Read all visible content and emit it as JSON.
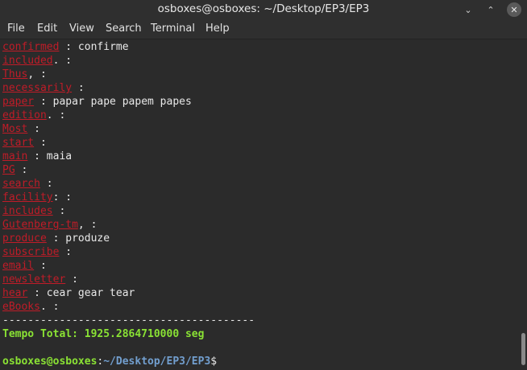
{
  "window": {
    "title": "osboxes@osboxes: ~/Desktop/EP3/EP3",
    "minimize": "⌄",
    "maximize": "⌃",
    "close": "✕"
  },
  "menu": [
    "File",
    "Edit",
    "View",
    "Search",
    "Terminal",
    "Help"
  ],
  "output": [
    {
      "word": "confirmed",
      "tail": " : confirme"
    },
    {
      "word": "included",
      "tail": ". :"
    },
    {
      "word": "Thus",
      "tail": ", :"
    },
    {
      "word": "necessarily",
      "tail": " :"
    },
    {
      "word": "paper",
      "tail": " : papar pape papem papes"
    },
    {
      "word": "edition",
      "tail": ". :"
    },
    {
      "word": "Most",
      "tail": " :"
    },
    {
      "word": "start",
      "tail": " :"
    },
    {
      "word": "main",
      "tail": " : maia"
    },
    {
      "word": "PG",
      "tail": " :"
    },
    {
      "word": "search",
      "tail": " :"
    },
    {
      "word": "facility",
      "tail": ": :"
    },
    {
      "word": "includes",
      "tail": " :"
    },
    {
      "word": "Gutenberg-tm",
      "tail": ", :"
    },
    {
      "word": "produce",
      "tail": " : produze"
    },
    {
      "word": "subscribe",
      "tail": " :"
    },
    {
      "word": "email",
      "tail": " :"
    },
    {
      "word": "newsletter",
      "tail": " :"
    },
    {
      "word": "hear",
      "tail": " : cear gear tear"
    },
    {
      "word": "eBooks",
      "tail": ". :"
    }
  ],
  "separator": "----------------------------------------",
  "total_time": "Tempo Total: 1925.2864710000 seg",
  "prompt": {
    "user_host": "osboxes@osboxes",
    "colon": ":",
    "path": "~/Desktop/EP3/EP3",
    "symbol": "$"
  }
}
